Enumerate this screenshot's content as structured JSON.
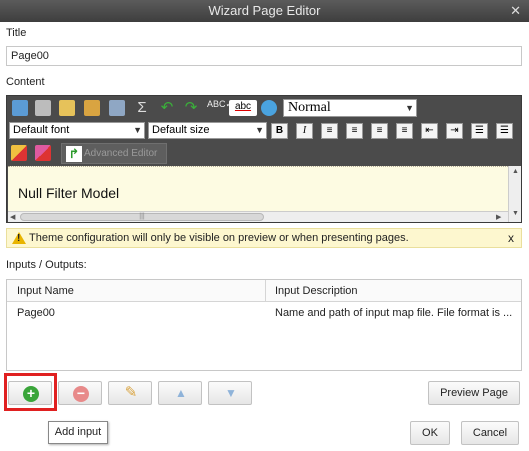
{
  "window": {
    "title": "Wizard Page Editor",
    "close_label": "✕"
  },
  "title_section": {
    "label": "Title",
    "value": "Page00"
  },
  "content_section": {
    "label": "Content",
    "style_select": "Normal",
    "font_select": "Default font",
    "size_select": "Default size",
    "advanced_editor_label": "Advanced Editor",
    "body_text": "Null Filter Model"
  },
  "warning": {
    "text": "Theme configuration will only be visible on preview or when presenting pages.",
    "close_label": "x"
  },
  "io_section": {
    "label": "Inputs / Outputs:",
    "columns": [
      "Input Name",
      "Input Description"
    ],
    "rows": [
      [
        "Page00",
        "Name and path of input map file. File format is ..."
      ]
    ]
  },
  "buttons": {
    "preview": "Preview Page",
    "ok": "OK",
    "cancel": "Cancel"
  },
  "tooltip": {
    "text": "Add input"
  },
  "icons": [
    "copy-icon",
    "cut-icon",
    "paste-icon",
    "paste-special-icon",
    "print-icon",
    "sigma-icon",
    "undo-icon",
    "redo-icon",
    "spellcheck-icon",
    "abc-icon",
    "globe-icon",
    "bold-icon",
    "italic-icon",
    "align-left-icon",
    "align-center-icon",
    "align-right-icon",
    "justify-icon",
    "outdent-icon",
    "indent-icon",
    "ordered-list-icon",
    "unordered-list-icon",
    "pencil-icon",
    "eraser-icon",
    "add-icon",
    "remove-icon",
    "edit-icon",
    "move-up-icon",
    "move-down-icon"
  ],
  "colors": {
    "accent_green": "#3aa53a",
    "remove_red": "#e25a5a",
    "highlight_red": "#e02020",
    "warning_bg": "#fdf7cf"
  }
}
